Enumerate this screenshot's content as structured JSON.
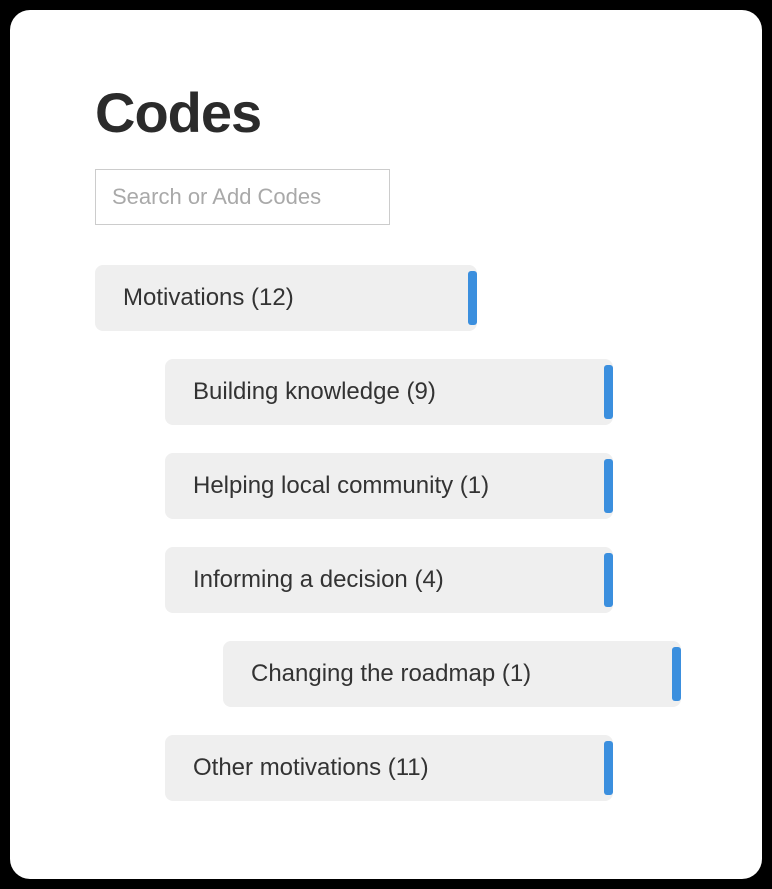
{
  "title": "Codes",
  "search": {
    "placeholder": "Search or Add Codes",
    "value": ""
  },
  "codes": [
    {
      "label": "Motivations (12)",
      "level": 0
    },
    {
      "label": "Building knowledge (9)",
      "level": 1
    },
    {
      "label": "Helping local community (1)",
      "level": 1
    },
    {
      "label": "Informing a decision (4)",
      "level": 1
    },
    {
      "label": "Changing the roadmap (1)",
      "level": 2
    },
    {
      "label": "Other motivations (11)",
      "level": 1
    }
  ]
}
